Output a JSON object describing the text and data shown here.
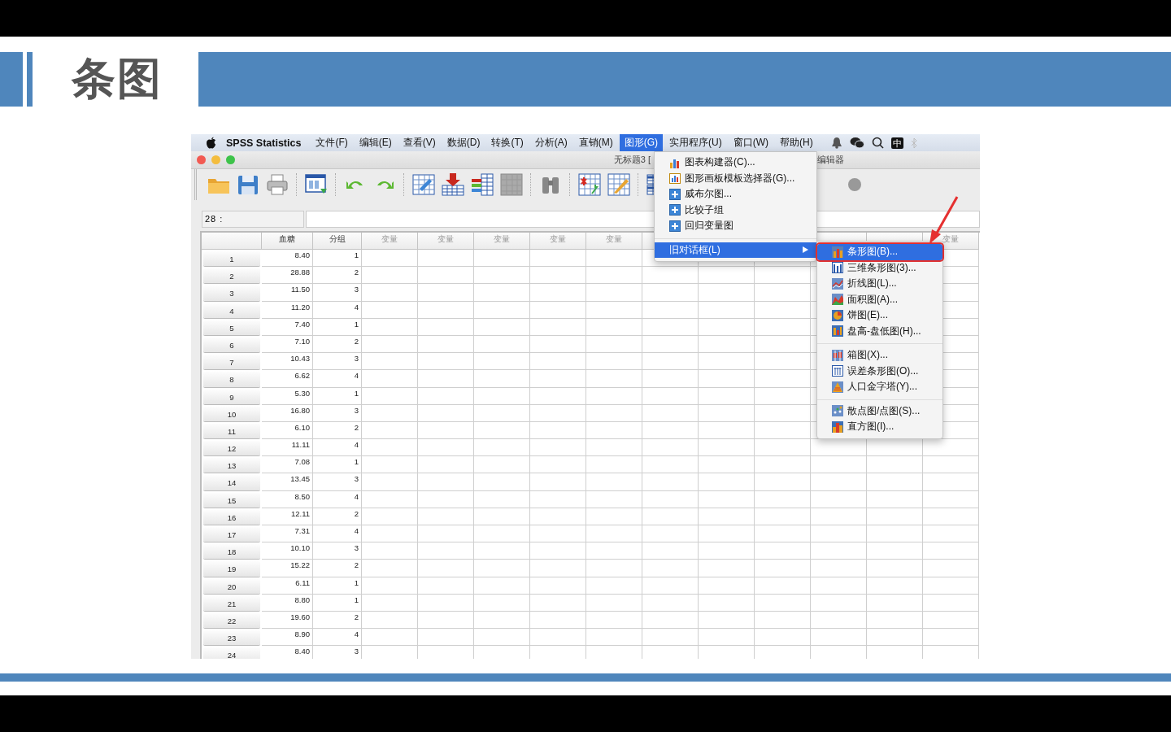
{
  "slide": {
    "title": "条图"
  },
  "app": {
    "menubar": {
      "app_name": "SPSS Statistics",
      "input_method": "中",
      "menus": [
        {
          "label": "文件(F)",
          "selected": false
        },
        {
          "label": "编辑(E)",
          "selected": false
        },
        {
          "label": "查看(V)",
          "selected": false
        },
        {
          "label": "数据(D)",
          "selected": false
        },
        {
          "label": "转换(T)",
          "selected": false
        },
        {
          "label": "分析(A)",
          "selected": false
        },
        {
          "label": "直销(M)",
          "selected": false
        },
        {
          "label": "图形(G)",
          "selected": true
        },
        {
          "label": "实用程序(U)",
          "selected": false
        },
        {
          "label": "窗口(W)",
          "selected": false
        },
        {
          "label": "帮助(H)",
          "selected": false
        }
      ]
    },
    "window": {
      "title_left": "无标题3 [",
      "title_right": "编辑器"
    },
    "cell_editor": {
      "cell_ref": "28 :"
    },
    "grid": {
      "columns": [
        "血糖",
        "分组",
        "变量",
        "变量",
        "变量",
        "变量",
        "变量"
      ],
      "last_column": "变量",
      "rows": [
        {
          "id": "1",
          "values": [
            "8.40",
            "1"
          ]
        },
        {
          "id": "2",
          "values": [
            "28.88",
            "2"
          ]
        },
        {
          "id": "3",
          "values": [
            "11.50",
            "3"
          ]
        },
        {
          "id": "4",
          "values": [
            "11.20",
            "4"
          ]
        },
        {
          "id": "5",
          "values": [
            "7.40",
            "1"
          ]
        },
        {
          "id": "6",
          "values": [
            "7.10",
            "2"
          ]
        },
        {
          "id": "7",
          "values": [
            "10.43",
            "3"
          ]
        },
        {
          "id": "8",
          "values": [
            "6.62",
            "4"
          ]
        },
        {
          "id": "9",
          "values": [
            "5.30",
            "1"
          ]
        },
        {
          "id": "10",
          "values": [
            "16.80",
            "3"
          ]
        },
        {
          "id": "11",
          "values": [
            "6.10",
            "2"
          ]
        },
        {
          "id": "12",
          "values": [
            "11.11",
            "4"
          ]
        },
        {
          "id": "13",
          "values": [
            "7.08",
            "1"
          ]
        },
        {
          "id": "14",
          "values": [
            "13.45",
            "3"
          ]
        },
        {
          "id": "15",
          "values": [
            "8.50",
            "4"
          ]
        },
        {
          "id": "16",
          "values": [
            "12.11",
            "2"
          ]
        },
        {
          "id": "17",
          "values": [
            "7.31",
            "4"
          ]
        },
        {
          "id": "18",
          "values": [
            "10.10",
            "3"
          ]
        },
        {
          "id": "19",
          "values": [
            "15.22",
            "2"
          ]
        },
        {
          "id": "20",
          "values": [
            "6.11",
            "1"
          ]
        },
        {
          "id": "21",
          "values": [
            "8.80",
            "1"
          ]
        },
        {
          "id": "22",
          "values": [
            "19.60",
            "2"
          ]
        },
        {
          "id": "23",
          "values": [
            "8.90",
            "4"
          ]
        },
        {
          "id": "24",
          "values": [
            "8.40",
            "3"
          ]
        }
      ]
    },
    "menu": {
      "groups": [
        [
          {
            "label": "图表构建器(C)...",
            "selected": false,
            "has_submenu": false
          },
          {
            "label": "图形画板模板选择器(G)...",
            "selected": false,
            "has_submenu": false
          },
          {
            "label": "威布尔图...",
            "selected": false,
            "has_submenu": false
          },
          {
            "label": "比较子组",
            "selected": false,
            "has_submenu": false
          },
          {
            "label": "回归变量图",
            "selected": false,
            "has_submenu": false
          }
        ],
        [
          {
            "label": "旧对话框(L)",
            "selected": true,
            "has_submenu": true
          }
        ]
      ]
    },
    "submenu": {
      "groups": [
        [
          {
            "label": "条形图(B)...",
            "selected": true
          },
          {
            "label": "三维条形图(3)...",
            "selected": false
          },
          {
            "label": "折线图(L)...",
            "selected": false
          },
          {
            "label": "面积图(A)...",
            "selected": false
          },
          {
            "label": "饼图(E)...",
            "selected": false
          },
          {
            "label": "盘高-盘低图(H)...",
            "selected": false
          }
        ],
        [
          {
            "label": "箱图(X)...",
            "selected": false
          },
          {
            "label": "误差条形图(O)...",
            "selected": false
          },
          {
            "label": "人口金字塔(Y)...",
            "selected": false
          }
        ],
        [
          {
            "label": "散点图/点图(S)...",
            "selected": false
          },
          {
            "label": "直方图(I)...",
            "selected": false
          }
        ]
      ]
    }
  }
}
